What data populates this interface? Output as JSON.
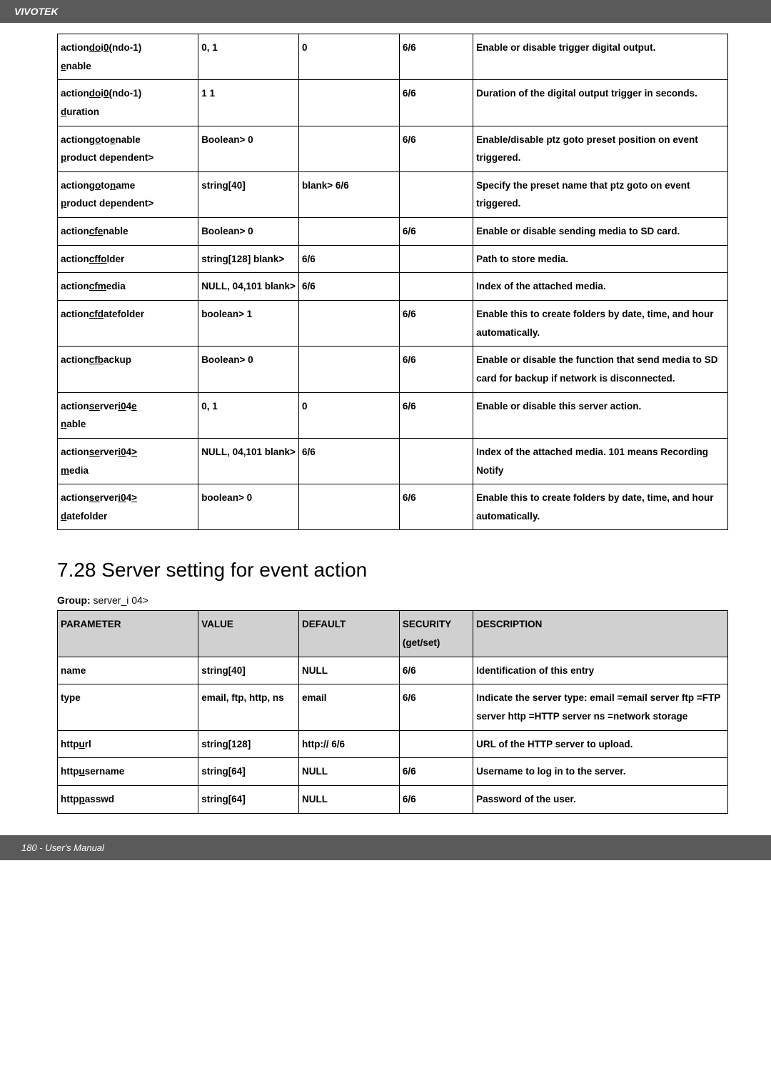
{
  "header": {
    "brand": "VIVOTEK"
  },
  "table1": {
    "rows": [
      {
        "p0": "action",
        "pu1": "do",
        "p2": "i",
        "pu3": "0",
        "p4": "(ndo-1)",
        "line2u": "e",
        "line2": "nable",
        "value": "0, 1",
        "default": "0",
        "security": "6/6",
        "desc": "Enable or disable trigger digital output."
      },
      {
        "p0": "action",
        "pu1": "do",
        "p2": "i",
        "pu3": "0",
        "p4": "(ndo-1)",
        "line2u": "d",
        "line2": "uration",
        "value": "1          1",
        "default": "",
        "security": "6/6",
        "desc": "Duration of the digital output trigger in seconds."
      },
      {
        "p0": "action",
        "pu1": "go",
        "p2": "to",
        "pu3": "e",
        "p4": "nable",
        "line2u": "p",
        "line2": "roduct dependent>",
        "value": "Boolean>     0",
        "default": "",
        "security": "6/6",
        "desc": "Enable/disable ptz goto preset position on event triggered."
      },
      {
        "p0": "action",
        "pu1": "go",
        "p2": "to",
        "pu3": "n",
        "p4": "ame",
        "line2u": "p",
        "line2": "roduct dependent>",
        "value": "string[40]",
        "default": "blank>         6/6",
        "security": "",
        "desc": "Specify the preset name that ptz goto on event triggered."
      },
      {
        "p0": "action",
        "pu1": "cf",
        "p2": "",
        "pu3": "e",
        "p4": "nable",
        "value": "Boolean>     0",
        "default": "",
        "security": "6/6",
        "desc": "Enable or disable sending media to SD card."
      },
      {
        "p0": "action",
        "pu1": "cf",
        "p2": "",
        "pu3": "fo",
        "p4": "lder",
        "value": "string[128]       blank>",
        "default": "6/6",
        "security": "",
        "desc": "Path to store media."
      },
      {
        "p0": "action",
        "pu1": "cf",
        "p2": "",
        "pu3": "m",
        "p4": "edia",
        "value": "NULL, 04,101 blank>",
        "default": "6/6",
        "security": "",
        "desc": "Index of the attached media."
      },
      {
        "p0": "action",
        "pu1": "cf",
        "p2": "",
        "pu3": "d",
        "p4": "atefolder",
        "value": "boolean>     1",
        "default": "",
        "security": "6/6",
        "desc": "Enable this to create folders by date, time, and hour automatically."
      },
      {
        "p0": "action",
        "pu1": "cf",
        "p2": "",
        "pu3": "b",
        "p4": "ackup",
        "value": "Boolean>     0",
        "default": "",
        "security": "6/6",
        "desc": "Enable or disable the function that send media to SD card for backup if network is disconnected."
      },
      {
        "p0": "action",
        "pu1": "se",
        "p2": "rver",
        "pu3": "i0",
        "p4": "4",
        "pu5": "e",
        "line2u": "n",
        "line2": "able",
        "value": "0, 1",
        "default": "0",
        "security": "6/6",
        "desc": "Enable or disable this server action."
      },
      {
        "p0": "action",
        "pu1": "se",
        "p2": "rver",
        "pu3": "i0",
        "p4": "4",
        "pu5": ">",
        "line2u": "m",
        "line2": "edia",
        "value": "NULL, 04,101 blank>",
        "default": "6/6",
        "security": "",
        "desc": "Index of the attached media. 101 means Recording Notify"
      },
      {
        "p0": "action",
        "pu1": "se",
        "p2": "rver",
        "pu3": "i0",
        "p4": "4",
        "pu5": ">",
        "line2u": "d",
        "line2": "atefolder",
        "value": "boolean>     0",
        "default": "",
        "security": "6/6",
        "desc": "Enable this to create folders by date, time, and hour automatically."
      }
    ]
  },
  "section": {
    "heading": "7.28 Server setting for event action",
    "group_label": "Group:",
    "group_value": "server_i    04>"
  },
  "table2": {
    "headers": {
      "c1": "PARAMETER",
      "c2": "VALUE",
      "c3": "DEFAULT",
      "c4": "SECURITY (get/set)",
      "c5": "DESCRIPTION"
    },
    "rows": [
      {
        "param": "name",
        "value": "string[40]",
        "default": "NULL",
        "security": "6/6",
        "desc": "Identification of this entry"
      },
      {
        "param": "type",
        "value": "email, ftp, http, ns",
        "default": "email",
        "security": "6/6",
        "desc": "Indicate the server type: email =email server ftp =FTP server http =HTTP server ns =network storage"
      },
      {
        "p0": "http",
        "pu1": "u",
        "p2": "rl",
        "value": "string[128]",
        "default": "http://          6/6",
        "security": "",
        "desc": "URL of the HTTP server to upload."
      },
      {
        "p0": "http",
        "pu1": "u",
        "p2": "sername",
        "value": "string[64]",
        "default": "NULL",
        "security": "6/6",
        "desc": "Username to log in to the server."
      },
      {
        "p0": "http",
        "pu1": "p",
        "p2": "asswd",
        "value": "string[64]",
        "default": "NULL",
        "security": "6/6",
        "desc": "Password of the user."
      }
    ]
  },
  "footer": {
    "page": "180 - User's Manual"
  }
}
